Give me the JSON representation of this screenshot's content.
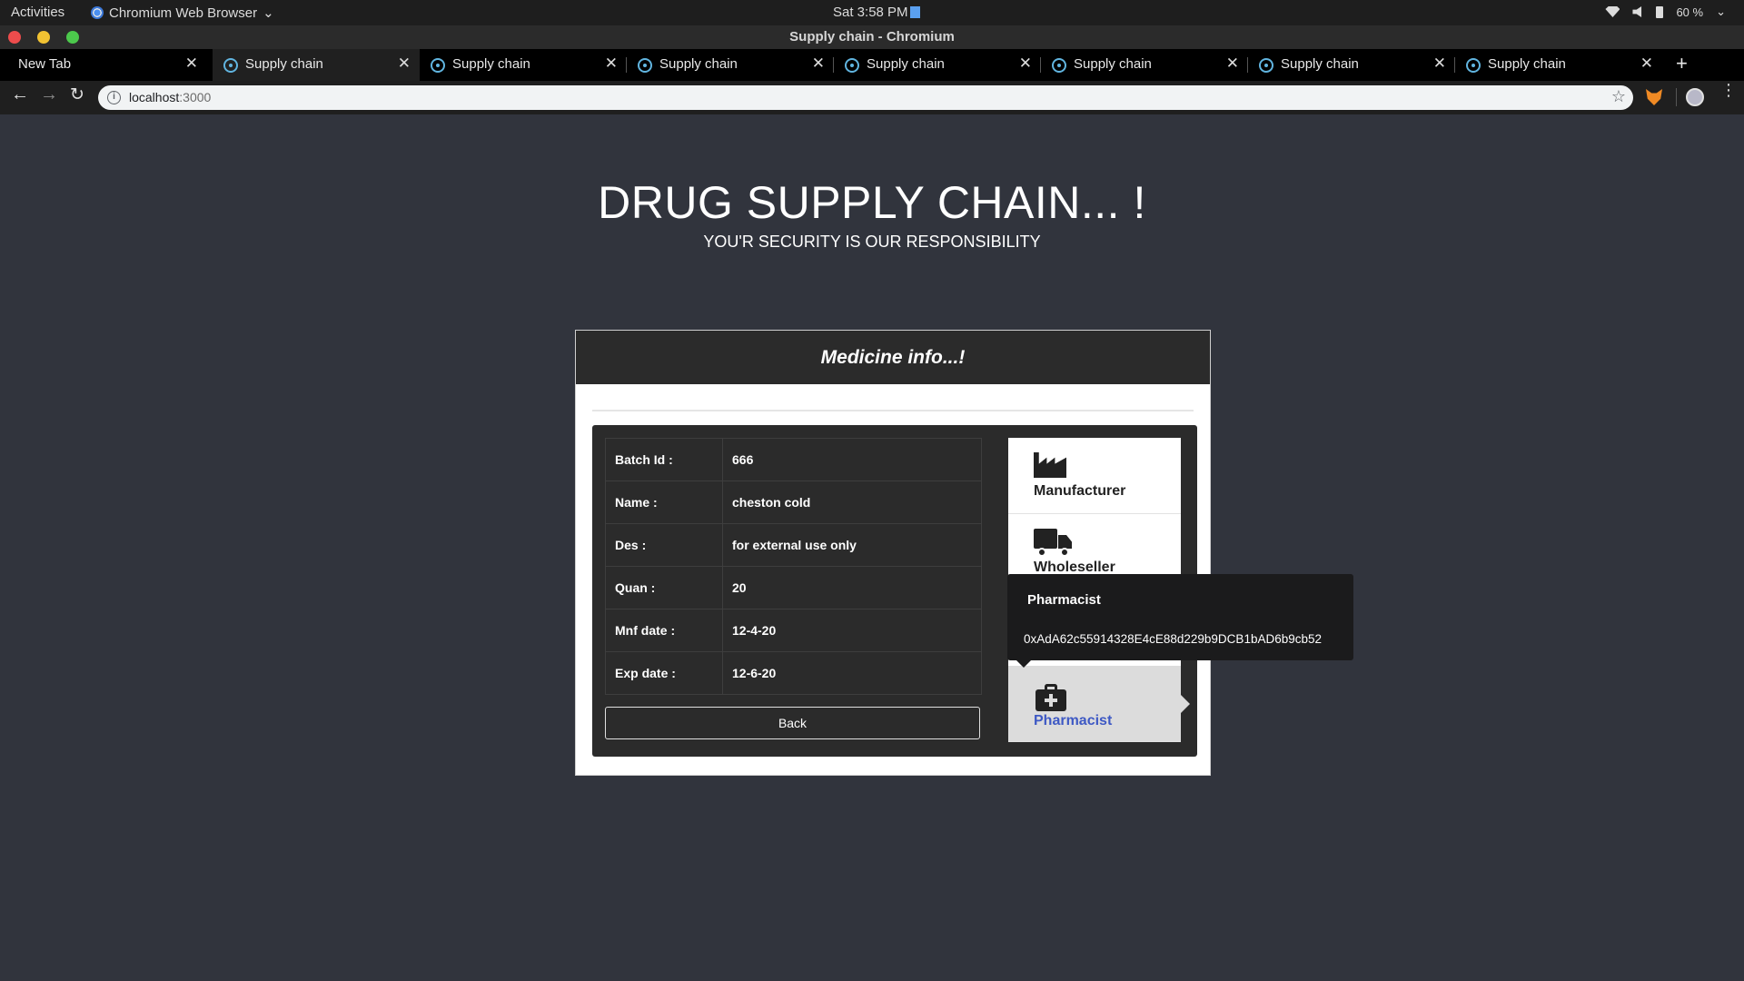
{
  "os": {
    "activities": "Activities",
    "app_name": "Chromium Web Browser",
    "clock": "Sat  3:58 PM",
    "battery": "60 %"
  },
  "window": {
    "title": "Supply chain - Chromium"
  },
  "tabs": [
    {
      "label": "New Tab"
    },
    {
      "label": "Supply chain"
    },
    {
      "label": "Supply chain"
    },
    {
      "label": "Supply chain"
    },
    {
      "label": "Supply chain"
    },
    {
      "label": "Supply chain"
    },
    {
      "label": "Supply chain"
    },
    {
      "label": "Supply chain"
    }
  ],
  "address_bar": {
    "host": "localhost",
    "port": ":3000"
  },
  "page": {
    "title": "DRUG SUPPLY CHAIN... !",
    "subtitle": "YOU'R SECURITY IS OUR RESPONSIBILITY",
    "card_title": "Medicine info...!",
    "info": [
      {
        "key": "Batch Id :",
        "value": "666"
      },
      {
        "key": "Name :",
        "value": "cheston cold"
      },
      {
        "key": "Des :",
        "value": "for external use only"
      },
      {
        "key": "Quan :",
        "value": "20"
      },
      {
        "key": "Mnf date :",
        "value": "12-4-20"
      },
      {
        "key": "Exp date :",
        "value": "12-6-20"
      }
    ],
    "back_label": "Back",
    "steps": [
      {
        "label": "Manufacturer",
        "icon": "factory-icon"
      },
      {
        "label": "Wholeseller",
        "icon": "truck-icon"
      },
      {
        "label": "Pharmacist",
        "icon": "medkit-icon"
      }
    ],
    "tooltip": {
      "title": "Pharmacist",
      "address": "0xAdA62c55914328E4cE88d229b9DCB1bAD6b9cb52"
    }
  },
  "colors": {
    "page_bg": "#31343d",
    "panel_bg": "#2b2b2b",
    "active_step_text": "#3e59c4"
  }
}
